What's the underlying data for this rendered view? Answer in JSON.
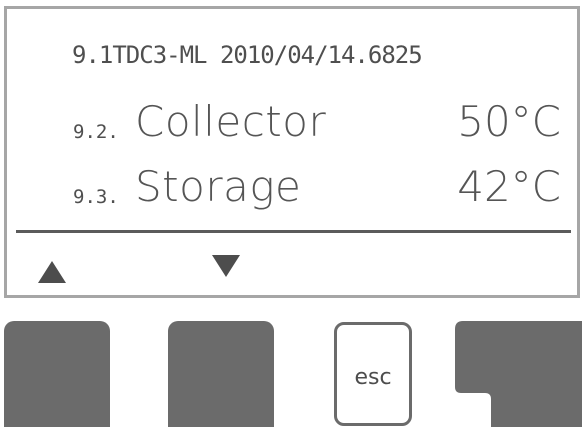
{
  "display": {
    "line1": "9.1TDC3-ML 2010/04/14.6825",
    "rows": [
      {
        "number": "9.2.",
        "label": "Collector",
        "value": "50°C"
      },
      {
        "number": "9.3.",
        "label": "Storage",
        "value": "42°C"
      }
    ],
    "softkeys": {
      "up": "up-arrow",
      "down": "down-arrow"
    }
  },
  "buttons": {
    "esc_label": "esc"
  },
  "colors": {
    "text": "#4f4f4f",
    "frame": "#a6a6a6",
    "button": "#6b6b6b"
  }
}
